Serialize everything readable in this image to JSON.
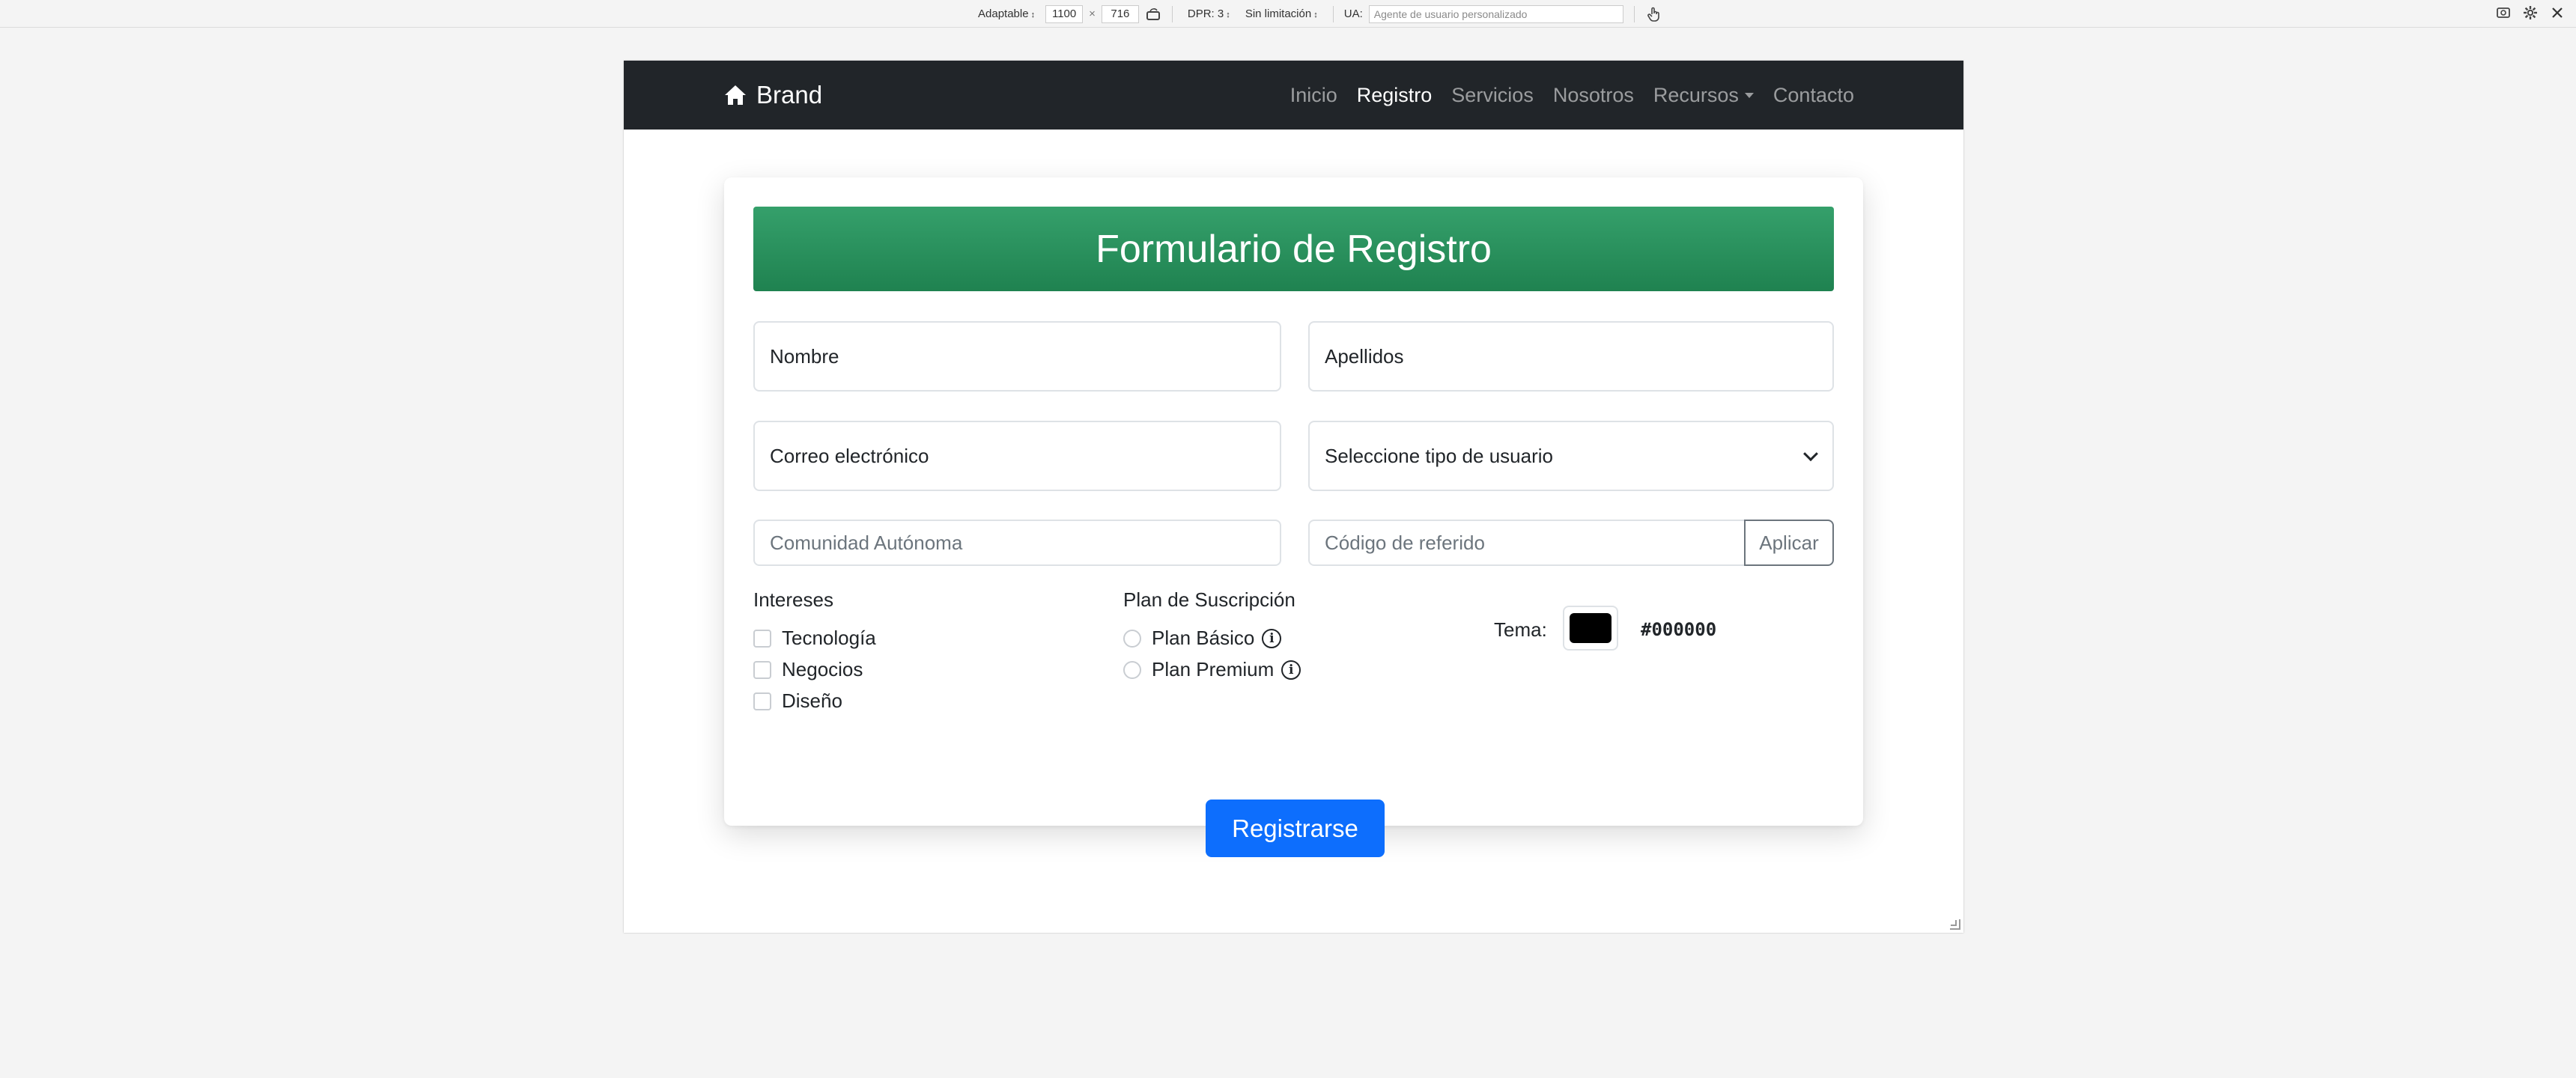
{
  "devtools": {
    "responsive_label": "Adaptable",
    "width": "1100",
    "times": "×",
    "height": "716",
    "dpr": "DPR: 3",
    "throttle": "Sin limitación",
    "ua_label": "UA:",
    "ua_placeholder": "Agente de usuario personalizado",
    "icons": [
      "rotate-icon",
      "touch-icon",
      "screenshot-icon",
      "settings-icon",
      "close-icon"
    ]
  },
  "navbar": {
    "brand": "Brand",
    "links": [
      {
        "label": "Inicio",
        "active": false
      },
      {
        "label": "Registro",
        "active": true
      },
      {
        "label": "Servicios",
        "active": false
      },
      {
        "label": "Nosotros",
        "active": false
      },
      {
        "label": "Recursos",
        "active": false,
        "dropdown": true
      },
      {
        "label": "Contacto",
        "active": false
      }
    ]
  },
  "form": {
    "title": "Formulario de Registro",
    "nombre": "Nombre",
    "apellidos": "Apellidos",
    "correo": "Correo electrónico",
    "tipo_usuario": "Seleccione tipo de usuario",
    "comunidad_placeholder": "Comunidad Autónoma",
    "referido_placeholder": "Código de referido",
    "aplicar": "Aplicar",
    "intereses_title": "Intereses",
    "intereses": [
      "Tecnología",
      "Negocios",
      "Diseño"
    ],
    "plan_title": "Plan de Suscripción",
    "planes": [
      "Plan Básico",
      "Plan Premium"
    ],
    "tema_label": "Tema:",
    "tema_color": "#000000",
    "tema_value": "#000000",
    "submit": "Registrarse",
    "header_color": "#2a9160",
    "primary_color": "#0d6efd"
  }
}
